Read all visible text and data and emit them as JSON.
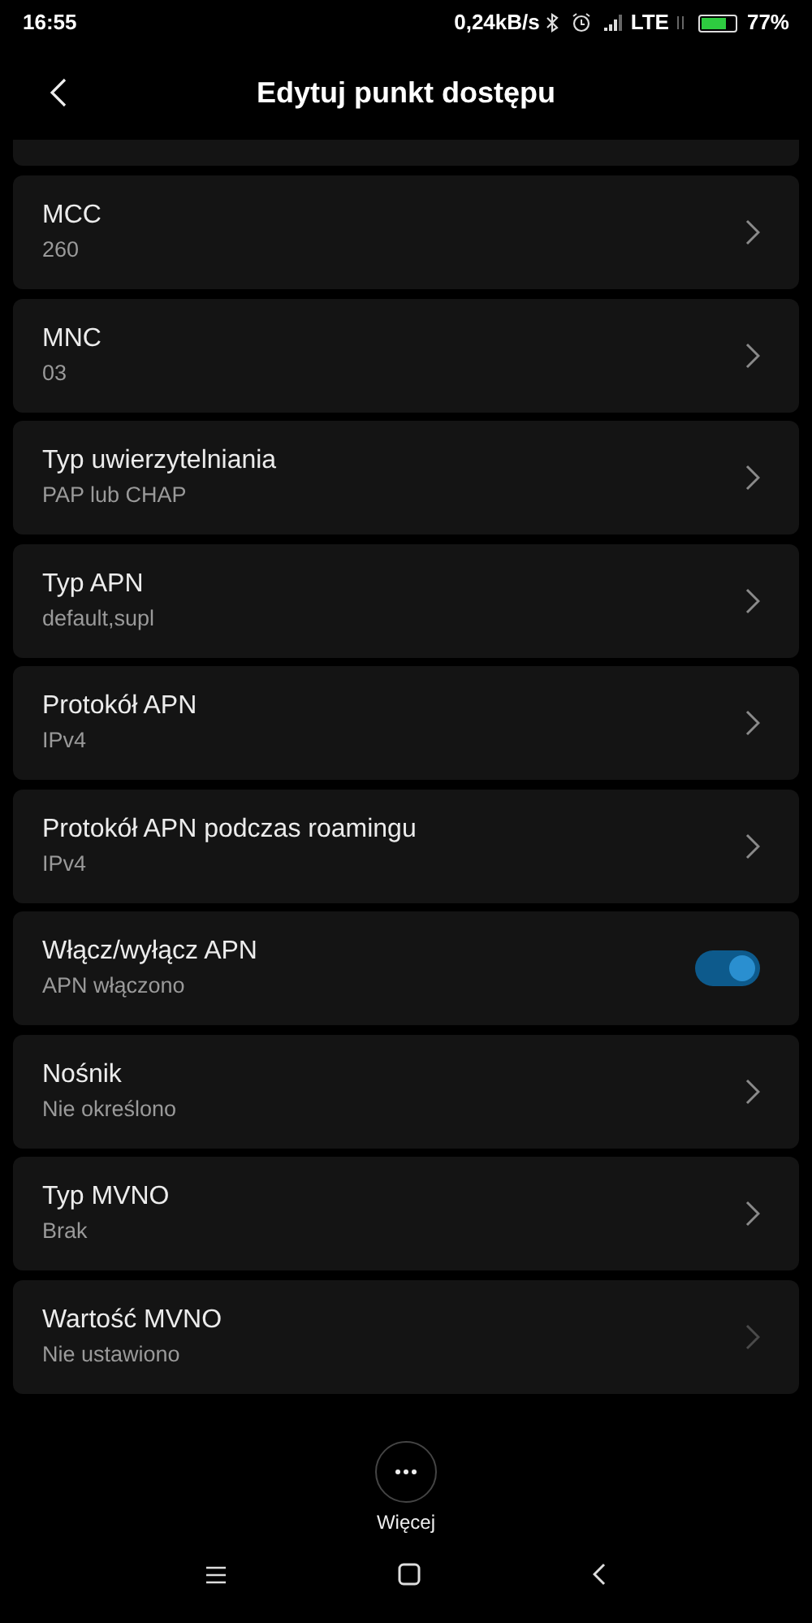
{
  "status_bar": {
    "time": "16:55",
    "speed": "0,24kB/s",
    "network": "LTE",
    "battery": "77%"
  },
  "header": {
    "title": "Edytuj punkt dostępu"
  },
  "items": [
    {
      "kind": "chevron",
      "title": "MCC",
      "value": "260",
      "disabled": false
    },
    {
      "kind": "chevron",
      "title": "MNC",
      "value": "03",
      "disabled": false
    },
    {
      "kind": "chevron",
      "title": "Typ uwierzytelniania",
      "value": "PAP lub CHAP",
      "disabled": false
    },
    {
      "kind": "chevron",
      "title": "Typ APN",
      "value": "default,supl",
      "disabled": false
    },
    {
      "kind": "chevron",
      "title": "Protokół APN",
      "value": "IPv4",
      "disabled": false
    },
    {
      "kind": "chevron",
      "title": "Protokół APN podczas roamingu",
      "value": "IPv4",
      "disabled": false
    },
    {
      "kind": "toggle",
      "title": "Włącz/wyłącz APN",
      "value": "APN włączono",
      "on": true
    },
    {
      "kind": "chevron",
      "title": "Nośnik",
      "value": "Nie określono",
      "disabled": false
    },
    {
      "kind": "chevron",
      "title": "Typ MVNO",
      "value": "Brak",
      "disabled": false
    },
    {
      "kind": "chevron",
      "title": "Wartość MVNO",
      "value": "Nie ustawiono",
      "disabled": true
    }
  ],
  "more_button": {
    "label": "Więcej"
  }
}
